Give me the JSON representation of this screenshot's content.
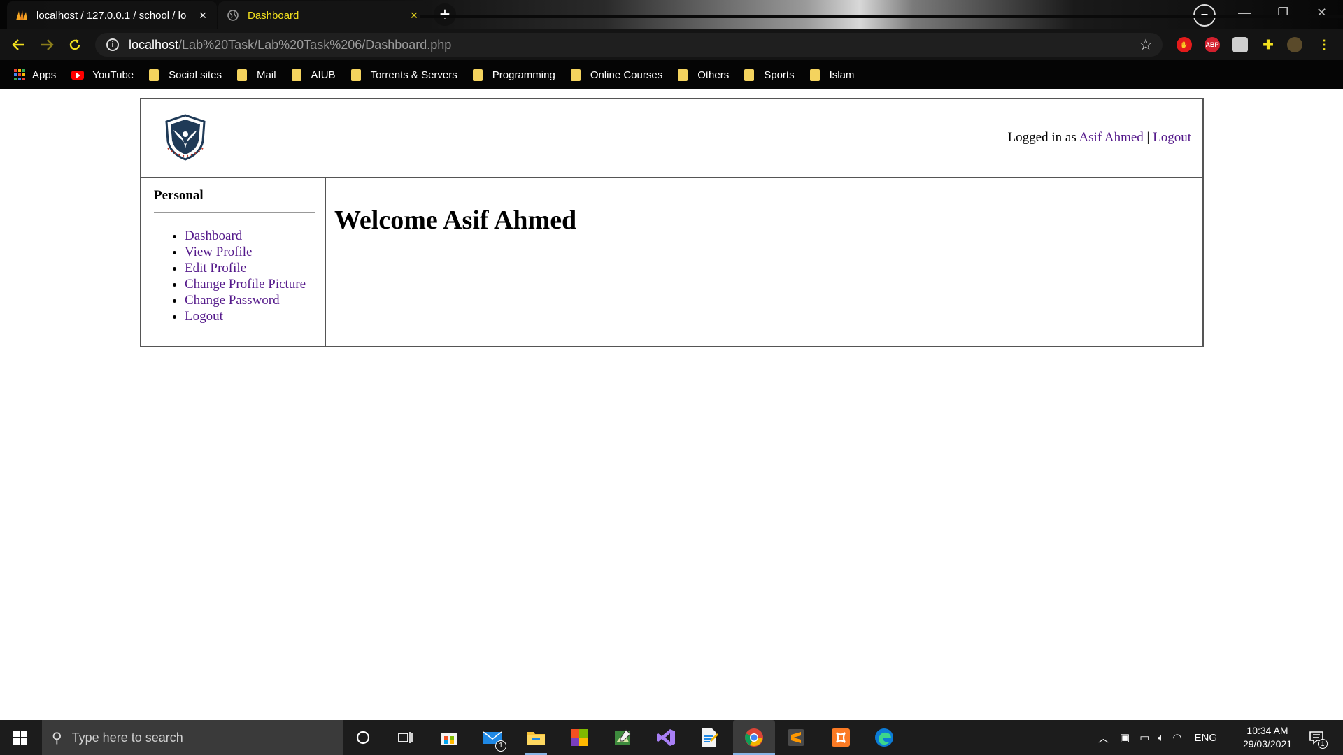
{
  "browser": {
    "tabs": [
      {
        "title": "localhost / 127.0.0.1 / school / lo",
        "active": false
      },
      {
        "title": "Dashboard",
        "active": true
      }
    ],
    "url": {
      "host": "localhost",
      "path": "/Lab%20Task/Lab%20Task%206/Dashboard.php"
    },
    "bookmarks": [
      {
        "label": "Apps",
        "icon": "apps-grid-icon"
      },
      {
        "label": "YouTube",
        "icon": "youtube-icon"
      },
      {
        "label": "Social sites",
        "icon": "folder-icon"
      },
      {
        "label": "Mail",
        "icon": "folder-icon"
      },
      {
        "label": "AIUB",
        "icon": "folder-icon"
      },
      {
        "label": "Torrents & Servers",
        "icon": "folder-icon"
      },
      {
        "label": "Programming",
        "icon": "folder-icon"
      },
      {
        "label": "Online Courses",
        "icon": "folder-icon"
      },
      {
        "label": "Others",
        "icon": "folder-icon"
      },
      {
        "label": "Sports",
        "icon": "folder-icon"
      },
      {
        "label": "Islam",
        "icon": "folder-icon"
      }
    ],
    "extensions": {
      "abp_label": "ABP"
    }
  },
  "header": {
    "logged_in_prefix": "Logged in as",
    "user_name": "Asif Ahmed",
    "separator": "|",
    "logout_label": "Logout"
  },
  "sidebar": {
    "title": "Personal",
    "items": [
      {
        "label": "Dashboard"
      },
      {
        "label": "View Profile"
      },
      {
        "label": "Edit Profile"
      },
      {
        "label": "Change Profile Picture"
      },
      {
        "label": "Change Password"
      },
      {
        "label": "Logout"
      }
    ]
  },
  "main": {
    "heading": "Welcome Asif Ahmed"
  },
  "taskbar": {
    "search_placeholder": "Type here to search",
    "mail_badge": "1",
    "language": "ENG",
    "time": "10:34 AM",
    "date": "29/03/2021",
    "notification_count": "1"
  },
  "colors": {
    "link": "#551a8b",
    "active_tab_text": "#f2e01e",
    "tab_bg": "#141414"
  }
}
